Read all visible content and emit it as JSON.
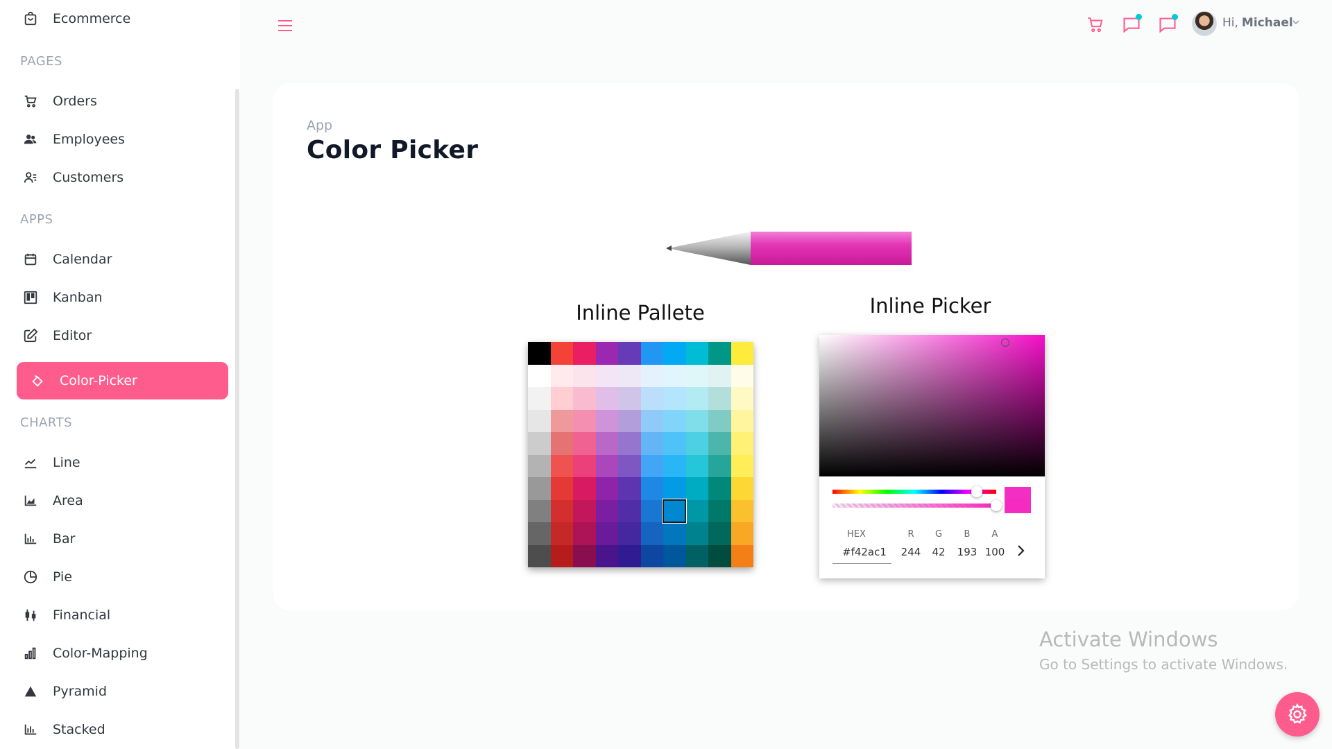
{
  "sidebar": {
    "top_item": "Ecommerce",
    "sections": {
      "pages": "PAGES",
      "apps": "APPS",
      "charts": "CHARTS"
    },
    "pages": [
      "Orders",
      "Employees",
      "Customers"
    ],
    "apps": [
      "Calendar",
      "Kanban",
      "Editor",
      "Color-Picker"
    ],
    "charts": [
      "Line",
      "Area",
      "Bar",
      "Pie",
      "Financial",
      "Color-Mapping",
      "Pyramid",
      "Stacked"
    ],
    "active": "Color-Picker"
  },
  "topbar": {
    "greeting": "Hi,",
    "user": "Michael",
    "icons": [
      "menu-icon",
      "cart-icon",
      "chat-icon",
      "notification-icon",
      "chevron-down-icon"
    ],
    "accent": "#ff5c8e",
    "badge_color": "#03c9d7"
  },
  "page": {
    "breadcrumb": "App",
    "title": "Color Picker"
  },
  "palette": {
    "heading": "Inline Pallete",
    "selected_color": "#1976d2"
  },
  "picker": {
    "heading": "Inline Picker",
    "hex_label": "HEX",
    "hex_value": "#f42ac1",
    "r_label": "R",
    "g_label": "G",
    "b_label": "B",
    "a_label": "A",
    "r": "244",
    "g": "42",
    "b": "193",
    "a": "100",
    "current_color": "#f42ac1",
    "hue_level": 0.9,
    "alpha_level": 1.0
  },
  "watermark": {
    "line1": "Activate Windows",
    "line2": "Go to Settings to activate Windows."
  }
}
